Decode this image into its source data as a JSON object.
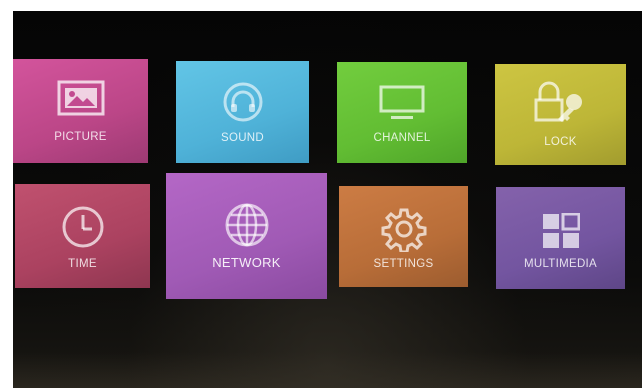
{
  "menu": {
    "tiles": [
      {
        "label": "PICTURE",
        "icon": "picture-icon",
        "color": "#c24a90"
      },
      {
        "label": "SOUND",
        "icon": "headphones-icon",
        "color": "#56b9dc"
      },
      {
        "label": "CHANNEL",
        "icon": "monitor-icon",
        "color": "#67c137"
      },
      {
        "label": "LOCK",
        "icon": "lock-key-icon",
        "color": "#c0b93a"
      },
      {
        "label": "TIME",
        "icon": "clock-icon",
        "color": "#b24565"
      },
      {
        "label": "NETWORK",
        "icon": "globe-icon",
        "color": "#a65bb8",
        "focused": true
      },
      {
        "label": "SETTINGS",
        "icon": "gear-icon",
        "color": "#c2733c"
      },
      {
        "label": "MULTIMEDIA",
        "icon": "grid-icon",
        "color": "#76559e"
      }
    ]
  }
}
